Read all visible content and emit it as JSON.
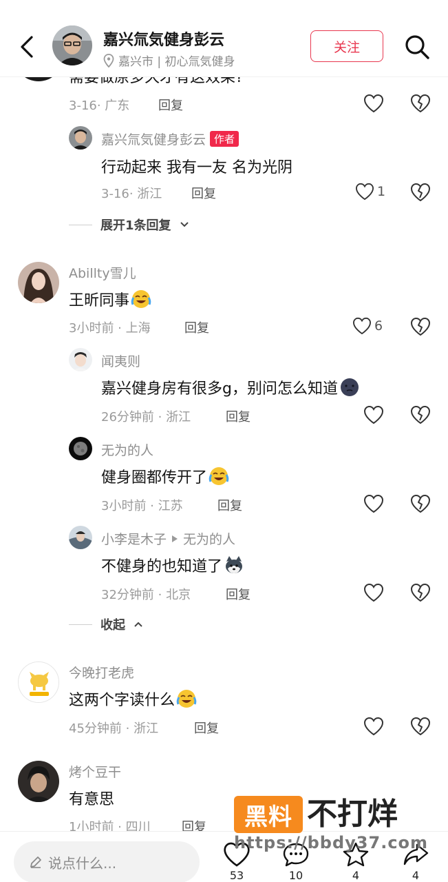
{
  "header": {
    "name": "嘉兴氚気健身彭云",
    "location": "嘉兴市 | 初心氚気健身",
    "follow_label": "关注"
  },
  "partial_comment": {
    "text": "需要做原多久才有这效果?",
    "time_location": "3-16· 广东",
    "reply_label": "回复"
  },
  "comments": [
    {
      "username": "嘉兴氚気健身彭云",
      "author_tag": "作者",
      "text": "行动起来 我有一友 名为光阴",
      "time_location": "3-16· 浙江",
      "reply_label": "回复",
      "likes": "1"
    },
    {
      "expand_label": "展开1条回复"
    },
    {
      "username": "Abillty雪儿",
      "text": "王昕同事",
      "time_location": "3小时前 · 上海",
      "reply_label": "回复",
      "likes": "6"
    },
    {
      "username": "闻夷则",
      "text": "嘉兴健身房有很多g，别问怎么知道",
      "time_location": "26分钟前 · 浙江",
      "reply_label": "回复"
    },
    {
      "username": "无为的人",
      "text": "健身圈都传开了",
      "time_location": "3小时前 · 江苏",
      "reply_label": "回复"
    },
    {
      "username": "小李是木子",
      "reply_to": "无为的人",
      "text": "不健身的也知道了",
      "time_location": "32分钟前 · 北京",
      "reply_label": "回复"
    },
    {
      "collapse_label": "收起"
    },
    {
      "username": "今晚打老虎",
      "text": "这两个字读什么",
      "time_location": "45分钟前 · 浙江",
      "reply_label": "回复"
    },
    {
      "username": "烤个豆干",
      "text": "有意思",
      "time_location": "1小时前 · 四川",
      "reply_label": "回复"
    }
  ],
  "watermark": {
    "box": "黑料",
    "text": "不打烊",
    "url": "https://bbdy37.com"
  },
  "bottom_bar": {
    "placeholder": "说点什么...",
    "likes": "53",
    "comments": "10",
    "favorites": "4",
    "shares": "4"
  },
  "colors": {
    "accent": "#e8364e",
    "author_tag": "#f0284a",
    "watermark_orange": "#f68a1e"
  },
  "icons": [
    "back-icon",
    "search-icon",
    "location-pin-icon",
    "heart-icon",
    "broken-heart-icon",
    "chevron-down-icon",
    "chevron-up-icon",
    "pencil-icon",
    "chat-bubble-icon",
    "star-icon",
    "share-icon"
  ]
}
